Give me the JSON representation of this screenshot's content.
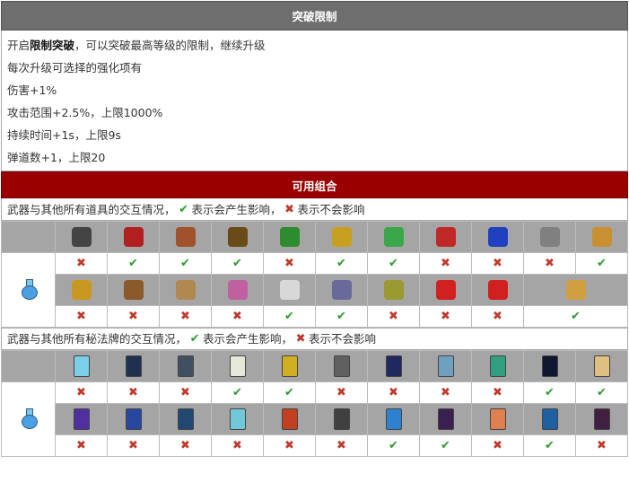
{
  "section_title": "突破限制",
  "desc": {
    "line1_prefix": "开启",
    "line1_bold": "限制突破",
    "line1_suffix": "，可以突破最高等级的限制，继续升级",
    "line2": "每次升级可选择的强化项有",
    "line3": "伤害+1%",
    "line4": "攻击范围+2.5%，上限1000%",
    "line5": "持续时间+1s，上限9s",
    "line6": "弹道数+1，上限20"
  },
  "combo_title": "可用组合",
  "note1": {
    "prefix": "武器与其他所有道具的交互情况，",
    "ok_text": "表示会产生影响，",
    "no_text": "表示不会影响"
  },
  "note2": {
    "prefix": "武器与其他所有秘法牌的交互情况，",
    "ok_text": "表示会产生影响，",
    "no_text": "表示不会影响"
  },
  "symbols": {
    "ok": "✔",
    "no": "✖"
  },
  "weapon_icon": "flask-icon",
  "items_row1": [
    {
      "icon": "heart-black-icon",
      "color": "#444444"
    },
    {
      "icon": "spellbook-red-icon",
      "color": "#b02020"
    },
    {
      "icon": "gauntlet-icon",
      "color": "#a0522d"
    },
    {
      "icon": "candelabra-icon",
      "color": "#6b4a1a"
    },
    {
      "icon": "clover-icon",
      "color": "#2e8b2e"
    },
    {
      "icon": "crown-icon",
      "color": "#c8a020"
    },
    {
      "icon": "feather-icon",
      "color": "#3aa84a"
    },
    {
      "icon": "heart-red-icon",
      "color": "#c02828"
    },
    {
      "icon": "orb-blue-icon",
      "color": "#2040c0"
    },
    {
      "icon": "gear-icon",
      "color": "#808080"
    },
    {
      "icon": "ring-gold-icon",
      "color": "#c89030"
    }
  ],
  "marks_row1": [
    "no",
    "ok",
    "ok",
    "ok",
    "no",
    "ok",
    "ok",
    "no",
    "no",
    "no",
    "ok"
  ],
  "items_row2": [
    {
      "icon": "armor-gold-icon",
      "color": "#c89820"
    },
    {
      "icon": "tome-icon",
      "color": "#8b5a2b"
    },
    {
      "icon": "helmet-icon",
      "color": "#b08850"
    },
    {
      "icon": "skull-icon",
      "color": "#c060a0"
    },
    {
      "icon": "wings-icon",
      "color": "#d8d8d8"
    },
    {
      "icon": "ring-silver-icon",
      "color": "#6a6a9a"
    },
    {
      "icon": "ring-green-icon",
      "color": "#9a9a30"
    },
    {
      "icon": "arrow-red-icon",
      "color": "#d02020"
    },
    {
      "icon": "arrow-red2-icon",
      "color": "#d02020"
    },
    {
      "icon": "scroll-gold-icon",
      "color": "#d0a040"
    }
  ],
  "marks_row2": [
    "no",
    "no",
    "no",
    "no",
    "ok",
    "ok",
    "no",
    "no",
    "no",
    "ok"
  ],
  "cards_row1": [
    {
      "icon": "card-ice-icon",
      "color": "#7ad0e8"
    },
    {
      "icon": "card-portal-icon",
      "color": "#203050"
    },
    {
      "icon": "card-skull-icon",
      "color": "#405060"
    },
    {
      "icon": "card-candle-icon",
      "color": "#e8e8d8"
    },
    {
      "icon": "card-sun-icon",
      "color": "#d0b020"
    },
    {
      "icon": "card-burst-icon",
      "color": "#606060"
    },
    {
      "icon": "card-vortex-icon",
      "color": "#202860"
    },
    {
      "icon": "card-stairs-icon",
      "color": "#70a0c0"
    },
    {
      "icon": "card-tree-icon",
      "color": "#30a080"
    },
    {
      "icon": "card-warp-icon",
      "color": "#101830"
    },
    {
      "icon": "card-gold-icon",
      "color": "#e0c080"
    }
  ],
  "marks_row3": [
    "no",
    "no",
    "no",
    "ok",
    "ok",
    "no",
    "no",
    "no",
    "no",
    "ok",
    "ok"
  ],
  "cards_row2": [
    {
      "icon": "card-wave-icon",
      "color": "#5030a0"
    },
    {
      "icon": "card-face-icon",
      "color": "#2848a0"
    },
    {
      "icon": "card-ring-icon",
      "color": "#204870"
    },
    {
      "icon": "card-frame-icon",
      "color": "#70c8d8"
    },
    {
      "icon": "card-rune-icon",
      "color": "#c04020"
    },
    {
      "icon": "card-snake-icon",
      "color": "#404040"
    },
    {
      "icon": "card-comet-icon",
      "color": "#3080d0"
    },
    {
      "icon": "card-figure-icon",
      "color": "#3a2050"
    },
    {
      "icon": "card-glow-icon",
      "color": "#e08050"
    },
    {
      "icon": "card-lightning-icon",
      "color": "#2060a0"
    },
    {
      "icon": "card-demon-icon",
      "color": "#402040"
    }
  ],
  "marks_row4": [
    "no",
    "no",
    "no",
    "no",
    "no",
    "no",
    "ok",
    "ok",
    "no",
    "ok",
    "no"
  ]
}
